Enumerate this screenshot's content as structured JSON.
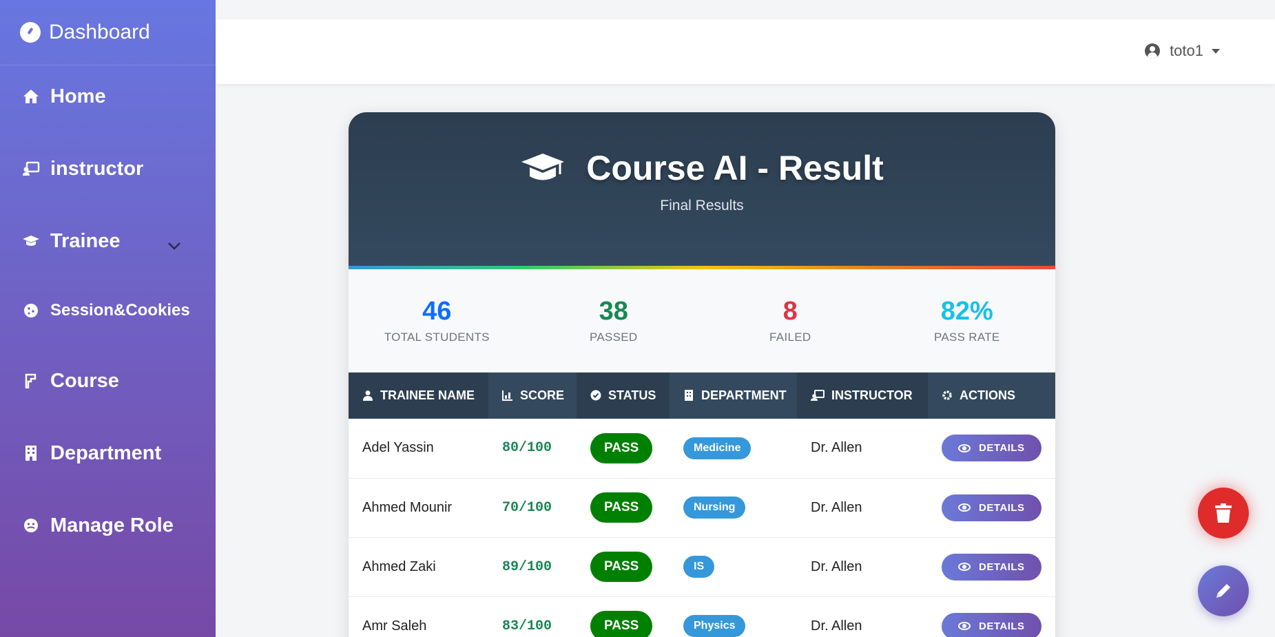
{
  "sidebar": {
    "brand": "Dashboard",
    "items": [
      {
        "label": "Home",
        "icon": "home-icon"
      },
      {
        "label": "instructor",
        "icon": "chalkboard-teacher-icon"
      },
      {
        "label": "Trainee",
        "icon": "graduation-cap-icon"
      },
      {
        "label": "Session&Cookies",
        "icon": "cookie-icon"
      },
      {
        "label": "Course",
        "icon": "course-icon"
      },
      {
        "label": "Department",
        "icon": "building-icon"
      },
      {
        "label": "Manage Role",
        "icon": "user-role-icon"
      }
    ]
  },
  "topbar": {
    "username": "toto1"
  },
  "card": {
    "title": "Course AI - Result",
    "subtitle": "Final Results"
  },
  "stats": [
    {
      "value": "46",
      "label": "TOTAL STUDENTS",
      "color": "#0d6efd"
    },
    {
      "value": "38",
      "label": "PASSED",
      "color": "#198754"
    },
    {
      "value": "8",
      "label": "FAILED",
      "color": "#dc3545"
    },
    {
      "value": "82%",
      "label": "PASS RATE",
      "color": "#17c1e8"
    }
  ],
  "table": {
    "headers": [
      "TRAINEE NAME",
      "SCORE",
      "STATUS",
      "DEPARTMENT",
      "INSTRUCTOR",
      "ACTIONS"
    ],
    "rows": [
      {
        "name": "Adel Yassin",
        "score": "80/100",
        "status": "PASS",
        "department": "Medicine",
        "instructor": "Dr. Allen",
        "action": "DETAILS"
      },
      {
        "name": "Ahmed Mounir",
        "score": "70/100",
        "status": "PASS",
        "department": "Nursing",
        "instructor": "Dr. Allen",
        "action": "DETAILS"
      },
      {
        "name": "Ahmed Zaki",
        "score": "89/100",
        "status": "PASS",
        "department": "IS",
        "instructor": "Dr. Allen",
        "action": "DETAILS"
      },
      {
        "name": "Amr Saleh",
        "score": "83/100",
        "status": "PASS",
        "department": "Physics",
        "instructor": "Dr. Allen",
        "action": "DETAILS"
      }
    ]
  }
}
